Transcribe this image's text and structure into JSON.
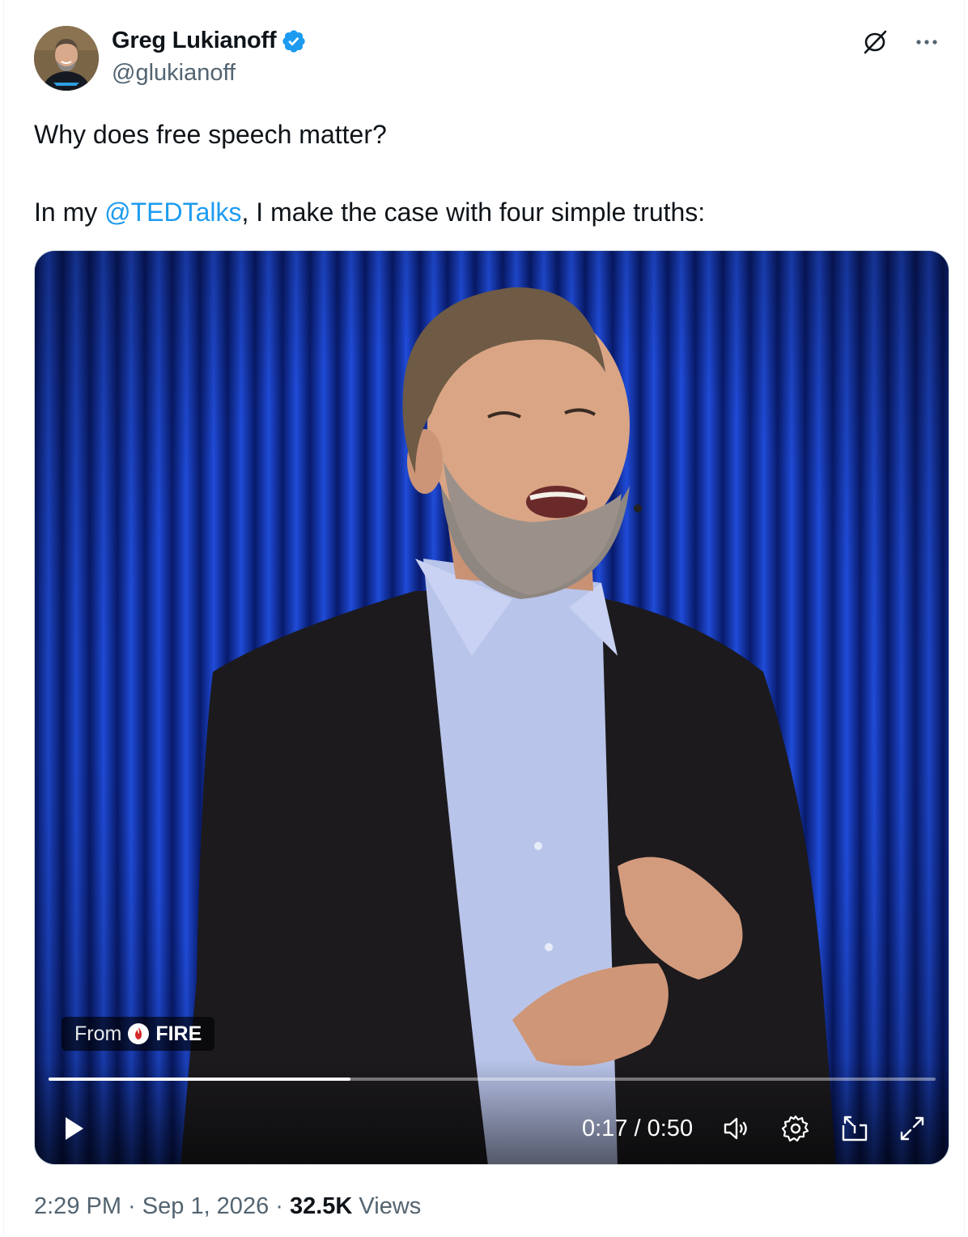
{
  "author": {
    "display_name": "Greg Lukianoff",
    "handle": "@glukianoff",
    "verified": true,
    "avatar_icon": "profile-photo"
  },
  "header_actions": {
    "grok_icon": "grok-icon",
    "more_icon": "more-options-icon"
  },
  "tweet": {
    "line1": "Why does free speech matter?",
    "line2_prefix": "In my ",
    "line2_mention": "@TEDTalks",
    "line2_suffix": ", I make the case with four simple truths:"
  },
  "media": {
    "source_from_label": "From",
    "source_brand": "FIRE",
    "time_current": "0:17",
    "time_separator": " / ",
    "time_total": "0:50",
    "progress_fraction": 0.34,
    "colors": {
      "mention": "#1d9bf0",
      "curtain": "#0a2a8a",
      "verified_badge": "#1d9bf0",
      "fire_brand": "#d42a2a"
    }
  },
  "meta": {
    "time": "2:29 PM",
    "date": "Sep 1, 2026",
    "separator": " · ",
    "views_count": "32.5K",
    "views_label": " Views"
  }
}
